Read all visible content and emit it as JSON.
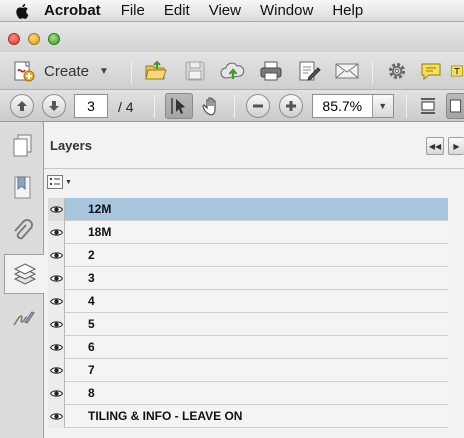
{
  "menubar": {
    "app": "Acrobat",
    "items": [
      "File",
      "Edit",
      "View",
      "Window",
      "Help"
    ]
  },
  "toolbar": {
    "create_label": "Create"
  },
  "nav": {
    "page_current": "3",
    "page_total": "/ 4",
    "zoom": "85.7%"
  },
  "panel": {
    "title": "Layers",
    "layers": [
      {
        "name": "12M",
        "selected": true
      },
      {
        "name": "18M",
        "selected": false
      },
      {
        "name": "2",
        "selected": false
      },
      {
        "name": "3",
        "selected": false
      },
      {
        "name": "4",
        "selected": false
      },
      {
        "name": "5",
        "selected": false
      },
      {
        "name": "6",
        "selected": false
      },
      {
        "name": "7",
        "selected": false
      },
      {
        "name": "8",
        "selected": false
      },
      {
        "name": "TILING & INFO - LEAVE ON",
        "selected": false
      }
    ]
  },
  "colors": {
    "selection": "#a7c6dd",
    "accent_green": "#4aa43a"
  }
}
